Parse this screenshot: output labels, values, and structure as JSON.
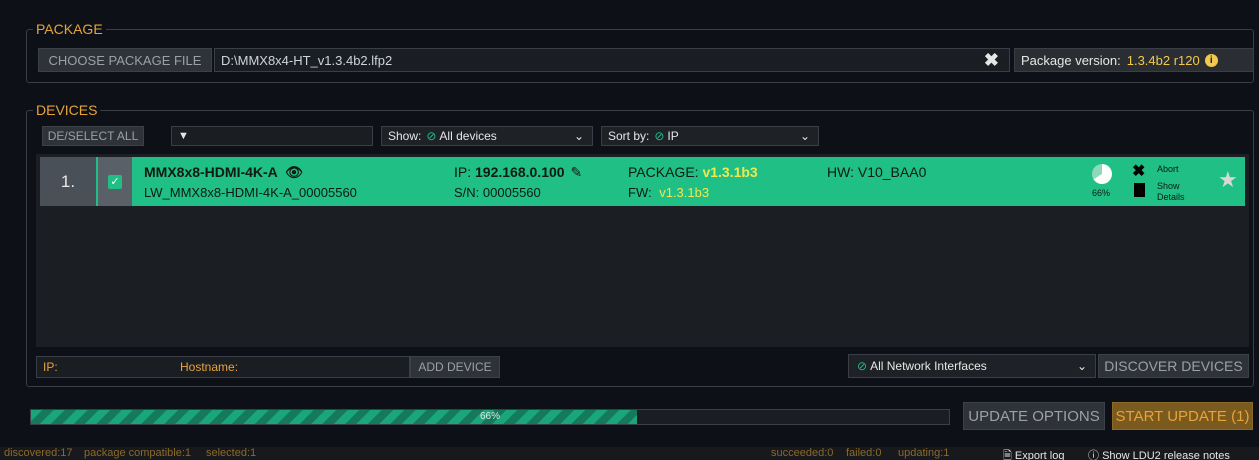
{
  "package": {
    "legend": "PACKAGE",
    "choose_label": "CHOOSE PACKAGE FILE",
    "file_path": "D:\\MMX8x4-HT_v1.3.4b2.lfp2",
    "version_label": "Package version:",
    "version_value": "1.3.4b2 r120"
  },
  "devices": {
    "legend": "DEVICES",
    "deselect_all": "DE/SELECT ALL",
    "filter_value": "",
    "show_label": "Show:",
    "show_value": "All devices",
    "sort_label": "Sort by:",
    "sort_value": "IP",
    "rows": [
      {
        "index": "1.",
        "name": "MMX8x8-HDMI-4K-A",
        "hostname": "LW_MMX8x8-HDMI-4K-A_00005560",
        "ip_label": "IP:",
        "ip_value": "192.168.0.100",
        "sn_label": "S/N:",
        "sn_value": "00005560",
        "package_label": "PACKAGE:",
        "package_value": "v1.3.1b3",
        "fw_label": "FW:",
        "fw_value": "v1.3.1b3",
        "hw_label": "HW:",
        "hw_value": "V10_BAA0",
        "progress_pct": "66%",
        "progress_fraction": 0.66,
        "abort_label": "Abort",
        "show_label": "Show",
        "details_label": "Details"
      }
    ],
    "ip_label": "IP:",
    "hostname_label": "Hostname:",
    "add_device": "ADD DEVICE",
    "network_interfaces": "All Network Interfaces",
    "discover_devices": "DISCOVER DEVICES"
  },
  "update": {
    "progress_text": "66%",
    "progress_fraction": 0.66,
    "options_label": "UPDATE OPTIONS",
    "start_label": "START UPDATE (1)"
  },
  "status": {
    "discovered": "discovered:17",
    "compatible": "package compatible:1",
    "selected": "selected:1",
    "succeeded": "succeeded:0",
    "failed": "failed:0",
    "updating": "updating:1",
    "export_log": "Export log",
    "release_notes": "Show LDU2 release notes"
  },
  "colors": {
    "accent": "#e8a33a",
    "row_green": "#1fbf86",
    "version_yellow": "#f2c94c"
  }
}
